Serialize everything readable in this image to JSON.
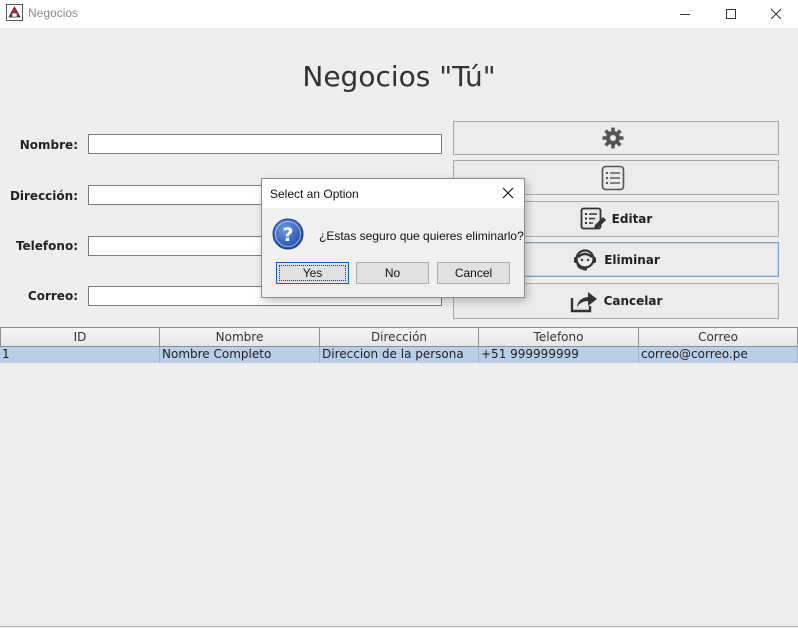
{
  "window": {
    "title": "Negocios",
    "controls": [
      "minimize-icon",
      "maximize-icon",
      "close-icon"
    ]
  },
  "header": {
    "title": "Negocios \"Tú\""
  },
  "form": {
    "fields": [
      {
        "label": "Nombre:",
        "value": ""
      },
      {
        "label": "Dirección:",
        "value": ""
      },
      {
        "label": "Telefono:",
        "value": ""
      },
      {
        "label": "Correo:",
        "value": ""
      }
    ]
  },
  "actions": [
    {
      "label": "",
      "icon": "gear-icon"
    },
    {
      "label": "",
      "icon": "list-icon"
    },
    {
      "label": "Editar",
      "icon": "edit-list-icon"
    },
    {
      "label": "Eliminar",
      "icon": "support-agent-icon"
    },
    {
      "label": "Cancelar",
      "icon": "share-icon"
    }
  ],
  "table": {
    "columns": [
      "ID",
      "Nombre",
      "Dirección",
      "Telefono",
      "Correo"
    ],
    "rows": [
      [
        "1",
        "Nombre Completo",
        "Direccion de la persona",
        "+51 999999999",
        "correo@correo.pe"
      ]
    ],
    "selected_row": 0
  },
  "dialog": {
    "title": "Select an Option",
    "message": "¿Estas seguro que quieres eliminarlo?",
    "icon": "question-icon",
    "buttons": {
      "yes": "Yes",
      "no": "No",
      "cancel": "Cancel"
    },
    "default_button": "yes"
  },
  "colors": {
    "background": "#eeeeee",
    "selection": "#b8cfe5",
    "question_icon": "#1f4fa8"
  }
}
